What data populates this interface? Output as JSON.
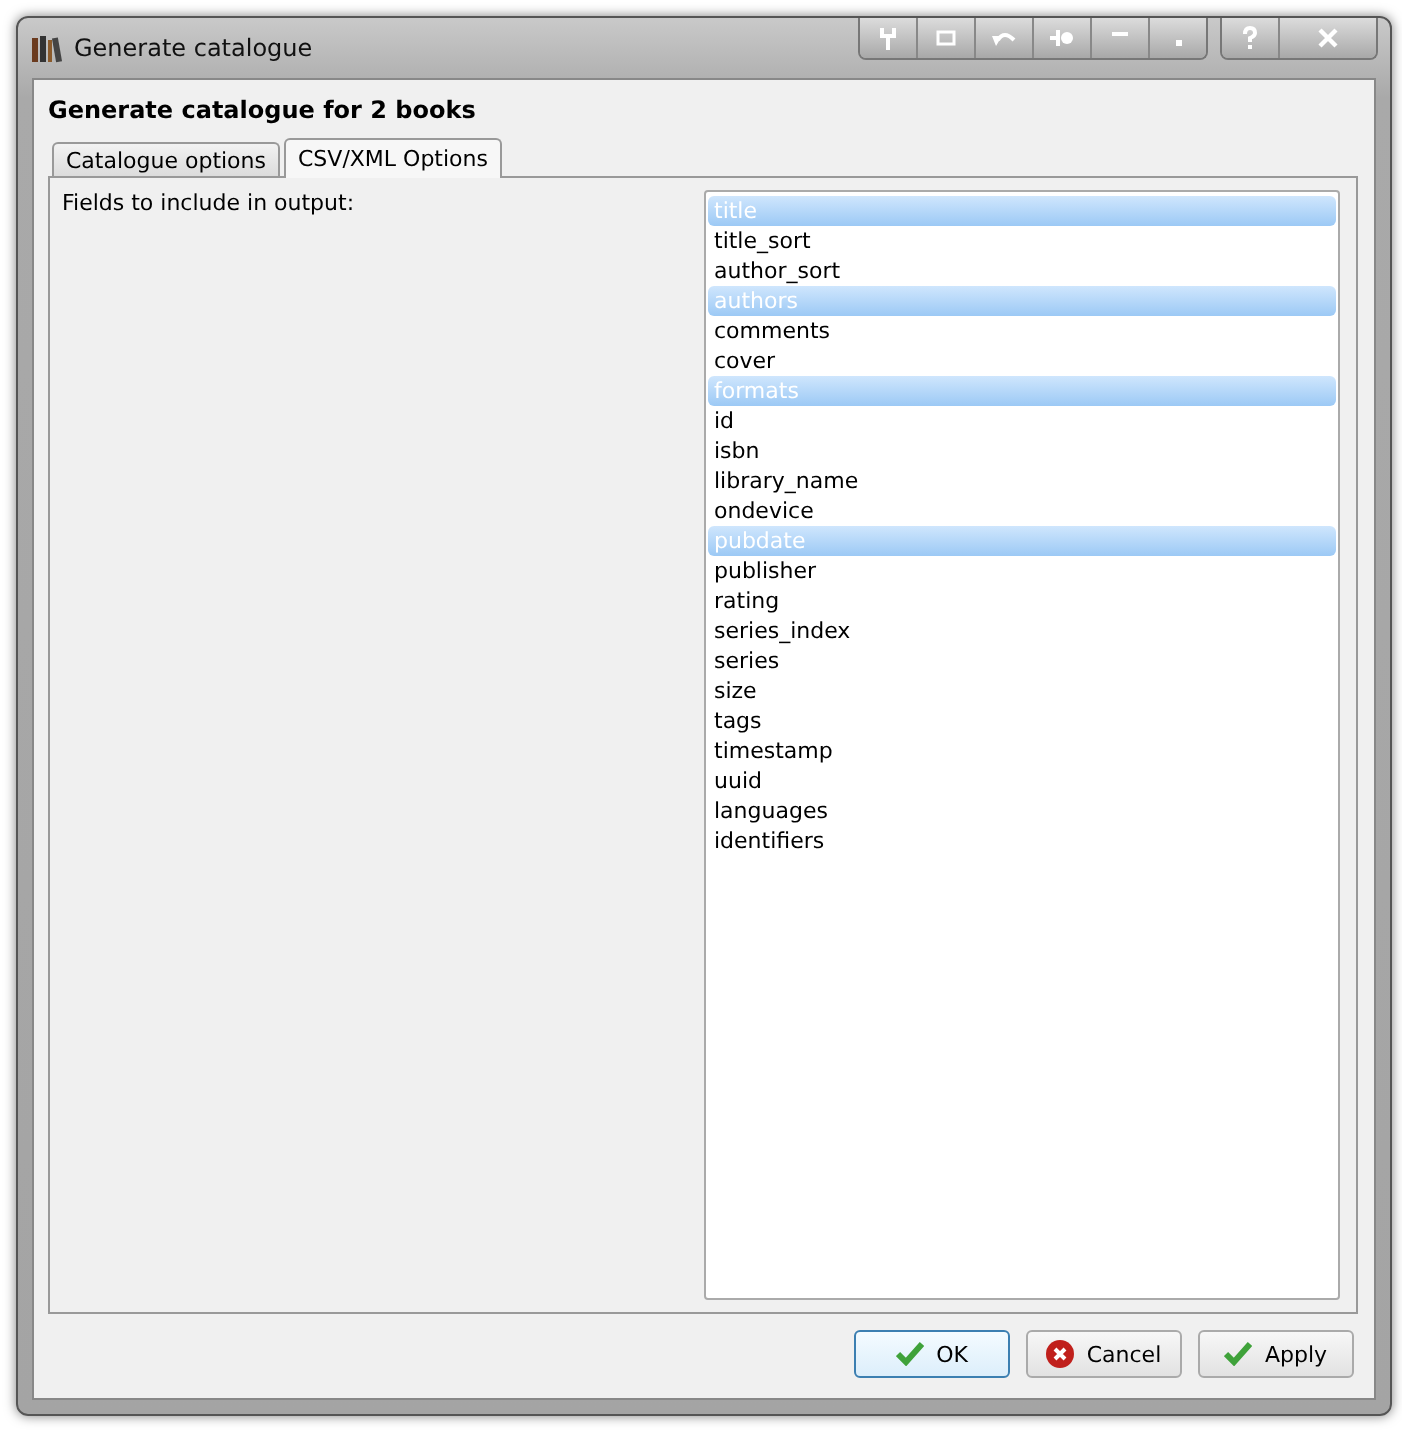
{
  "window": {
    "title": "Generate catalogue"
  },
  "heading": "Generate catalogue for 2 books",
  "tabs": [
    {
      "label": "Catalogue options",
      "selected": false
    },
    {
      "label": "CSV/XML Options",
      "selected": true
    }
  ],
  "fields_label": "Fields to include in output:",
  "fields": [
    {
      "label": "title",
      "selected": true
    },
    {
      "label": "title_sort",
      "selected": false
    },
    {
      "label": "author_sort",
      "selected": false
    },
    {
      "label": "authors",
      "selected": true
    },
    {
      "label": "comments",
      "selected": false
    },
    {
      "label": "cover",
      "selected": false
    },
    {
      "label": "formats",
      "selected": true
    },
    {
      "label": "id",
      "selected": false
    },
    {
      "label": "isbn",
      "selected": false
    },
    {
      "label": "library_name",
      "selected": false
    },
    {
      "label": "ondevice",
      "selected": false
    },
    {
      "label": "pubdate",
      "selected": true
    },
    {
      "label": "publisher",
      "selected": false
    },
    {
      "label": "rating",
      "selected": false
    },
    {
      "label": "series_index",
      "selected": false
    },
    {
      "label": "series",
      "selected": false
    },
    {
      "label": "size",
      "selected": false
    },
    {
      "label": "tags",
      "selected": false
    },
    {
      "label": "timestamp",
      "selected": false
    },
    {
      "label": "uuid",
      "selected": false
    },
    {
      "label": "languages",
      "selected": false
    },
    {
      "label": "identifiers",
      "selected": false
    }
  ],
  "buttons": [
    {
      "label": "OK",
      "kind": "ok",
      "default": true
    },
    {
      "label": "Cancel",
      "kind": "cancel",
      "default": false
    },
    {
      "label": "Apply",
      "kind": "ok",
      "default": false
    }
  ]
}
